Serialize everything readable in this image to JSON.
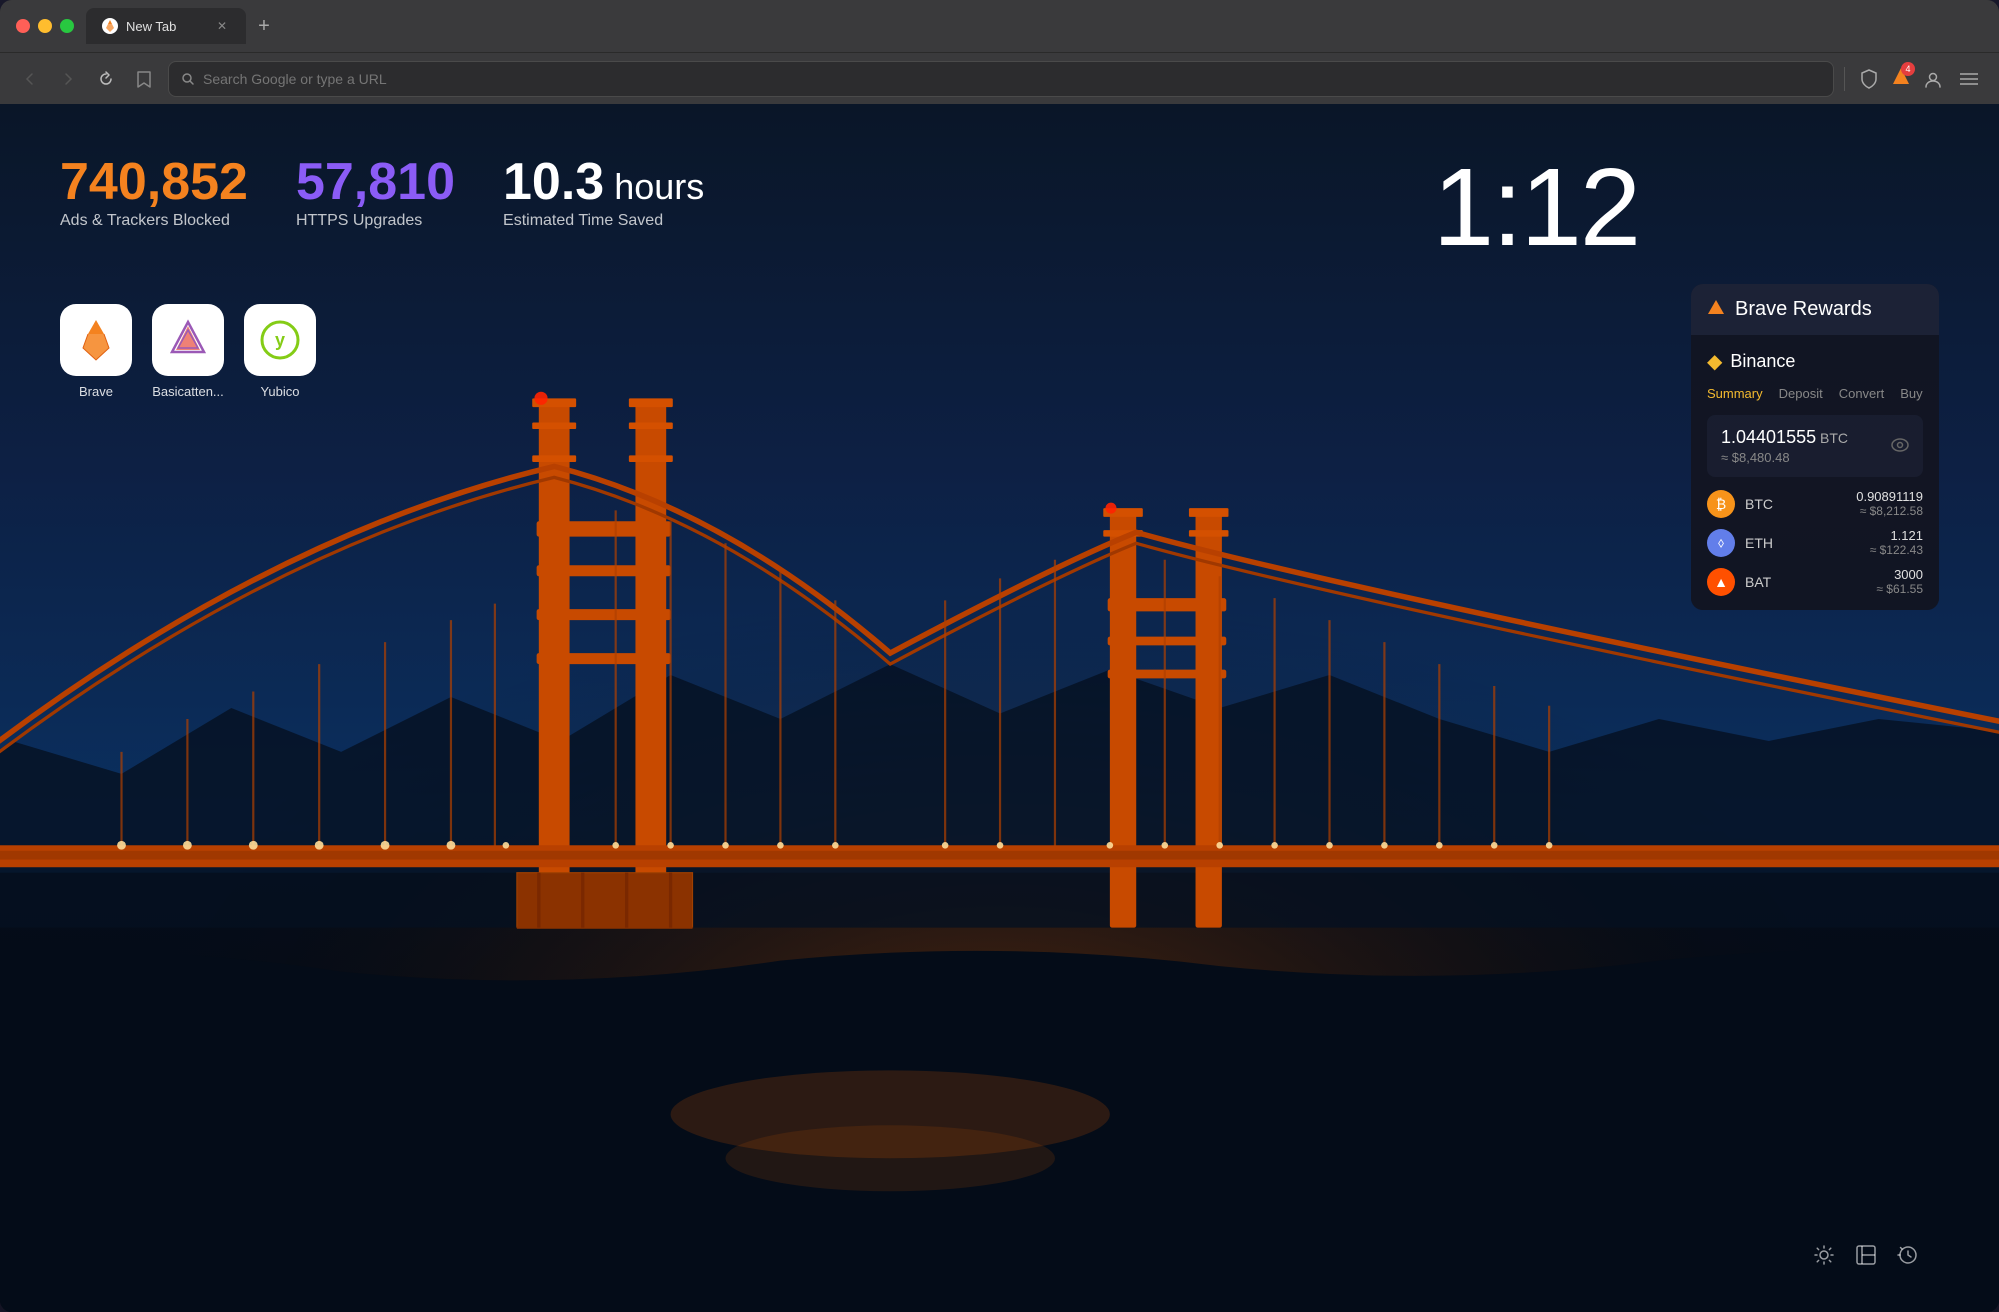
{
  "browser": {
    "tab_title": "New Tab",
    "traffic_lights": {
      "red": "#ff5f57",
      "yellow": "#ffbd2e",
      "green": "#28c840"
    }
  },
  "navbar": {
    "search_placeholder": "Search Google or type a URL",
    "back_label": "←",
    "forward_label": "→",
    "reload_label": "↻",
    "bookmark_label": "🔖",
    "new_tab_label": "+"
  },
  "stats": {
    "ads_value": "740,852",
    "ads_label": "Ads & Trackers Blocked",
    "https_value": "57,810",
    "https_label": "HTTPS Upgrades",
    "time_value": "10.3",
    "time_unit": " hours",
    "time_label": "Estimated Time Saved"
  },
  "clock": {
    "time": "1:12"
  },
  "quick_access": [
    {
      "name": "Brave",
      "label": "Brave"
    },
    {
      "name": "BasicAttention",
      "label": "Basicatten..."
    },
    {
      "name": "Yubico",
      "label": "Yubico"
    }
  ],
  "rewards_widget": {
    "title": "Brave Rewards"
  },
  "binance": {
    "title": "Binance",
    "tabs": [
      {
        "label": "Summary",
        "active": true
      },
      {
        "label": "Deposit",
        "active": false
      },
      {
        "label": "Convert",
        "active": false
      },
      {
        "label": "Buy",
        "active": false
      }
    ],
    "balance": {
      "value": "1.04401555",
      "unit": "BTC",
      "usd": "≈ $8,480.48"
    },
    "assets": [
      {
        "symbol": "BTC",
        "amount": "0.90891119",
        "usd": "≈ $8,212.58"
      },
      {
        "symbol": "ETH",
        "amount": "1.121",
        "usd": "≈ $122.43"
      },
      {
        "symbol": "BAT",
        "amount": "3000",
        "usd": "≈ $61.55"
      }
    ]
  },
  "bottom_icons": {
    "settings_label": "⚙",
    "bookmark_label": "⊞",
    "history_label": "⟳"
  }
}
